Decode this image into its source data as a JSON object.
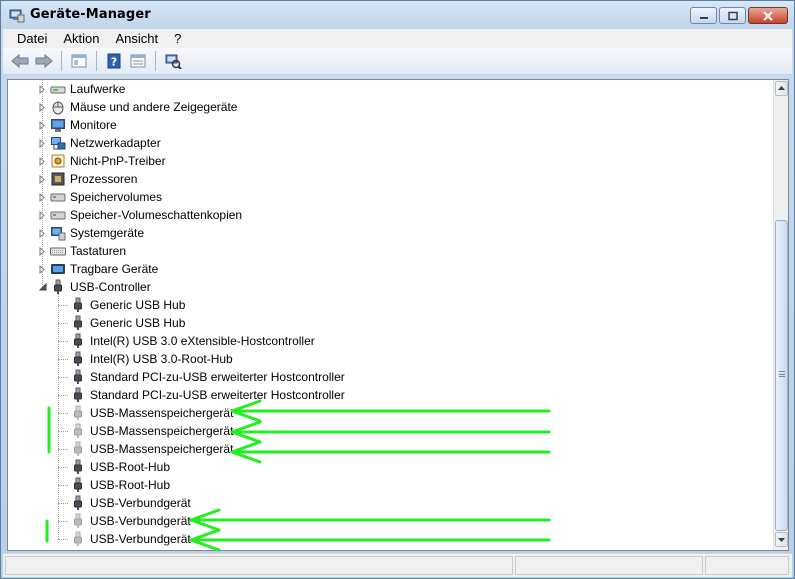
{
  "window": {
    "title": "Geräte-Manager"
  },
  "menu": {
    "items": [
      "Datei",
      "Aktion",
      "Ansicht",
      "?"
    ]
  },
  "toolbar": {
    "buttons": [
      "back-icon",
      "forward-icon",
      "show-hide-console-tree-icon",
      "help-icon",
      "properties-icon",
      "scan-hardware-icon"
    ]
  },
  "tree": {
    "categories": [
      {
        "label": "Laufwerke",
        "icon": "drive-icon",
        "expanded": false
      },
      {
        "label": "Mäuse und andere Zeigegeräte",
        "icon": "mouse-icon",
        "expanded": false
      },
      {
        "label": "Monitore",
        "icon": "monitor-icon",
        "expanded": false
      },
      {
        "label": "Netzwerkadapter",
        "icon": "network-icon",
        "expanded": false
      },
      {
        "label": "Nicht-PnP-Treiber",
        "icon": "driver-icon",
        "expanded": false
      },
      {
        "label": "Prozessoren",
        "icon": "cpu-icon",
        "expanded": false
      },
      {
        "label": "Speichervolumes",
        "icon": "volume-icon",
        "expanded": false
      },
      {
        "label": "Speicher-Volumeschattenkopien",
        "icon": "volume-icon",
        "expanded": false
      },
      {
        "label": "Systemgeräte",
        "icon": "system-device-icon",
        "expanded": false
      },
      {
        "label": "Tastaturen",
        "icon": "keyboard-icon",
        "expanded": false
      },
      {
        "label": "Tragbare Geräte",
        "icon": "portable-device-icon",
        "expanded": false
      },
      {
        "label": "USB-Controller",
        "icon": "usb-plug-icon",
        "expanded": true
      }
    ],
    "usb_children": [
      {
        "label": "Generic USB Hub",
        "hidden_device": false
      },
      {
        "label": "Generic USB Hub",
        "hidden_device": false
      },
      {
        "label": "Intel(R) USB 3.0 eXtensible-Hostcontroller",
        "hidden_device": false
      },
      {
        "label": "Intel(R) USB 3.0-Root-Hub",
        "hidden_device": false
      },
      {
        "label": "Standard PCI-zu-USB erweiterter Hostcontroller",
        "hidden_device": false
      },
      {
        "label": "Standard PCI-zu-USB erweiterter Hostcontroller",
        "hidden_device": false
      },
      {
        "label": "USB-Massenspeichergerät",
        "hidden_device": true
      },
      {
        "label": "USB-Massenspeichergerät",
        "hidden_device": true
      },
      {
        "label": "USB-Massenspeichergerät",
        "hidden_device": true
      },
      {
        "label": "USB-Root-Hub",
        "hidden_device": false
      },
      {
        "label": "USB-Root-Hub",
        "hidden_device": false
      },
      {
        "label": "USB-Verbundgerät",
        "hidden_device": false
      },
      {
        "label": "USB-Verbundgerät",
        "hidden_device": true
      },
      {
        "label": "USB-Verbundgerät",
        "hidden_device": true
      }
    ]
  },
  "colors": {
    "annotation": "#22ee22",
    "title_bg": "#c6dbf0",
    "close_btn": "#c8452b"
  }
}
